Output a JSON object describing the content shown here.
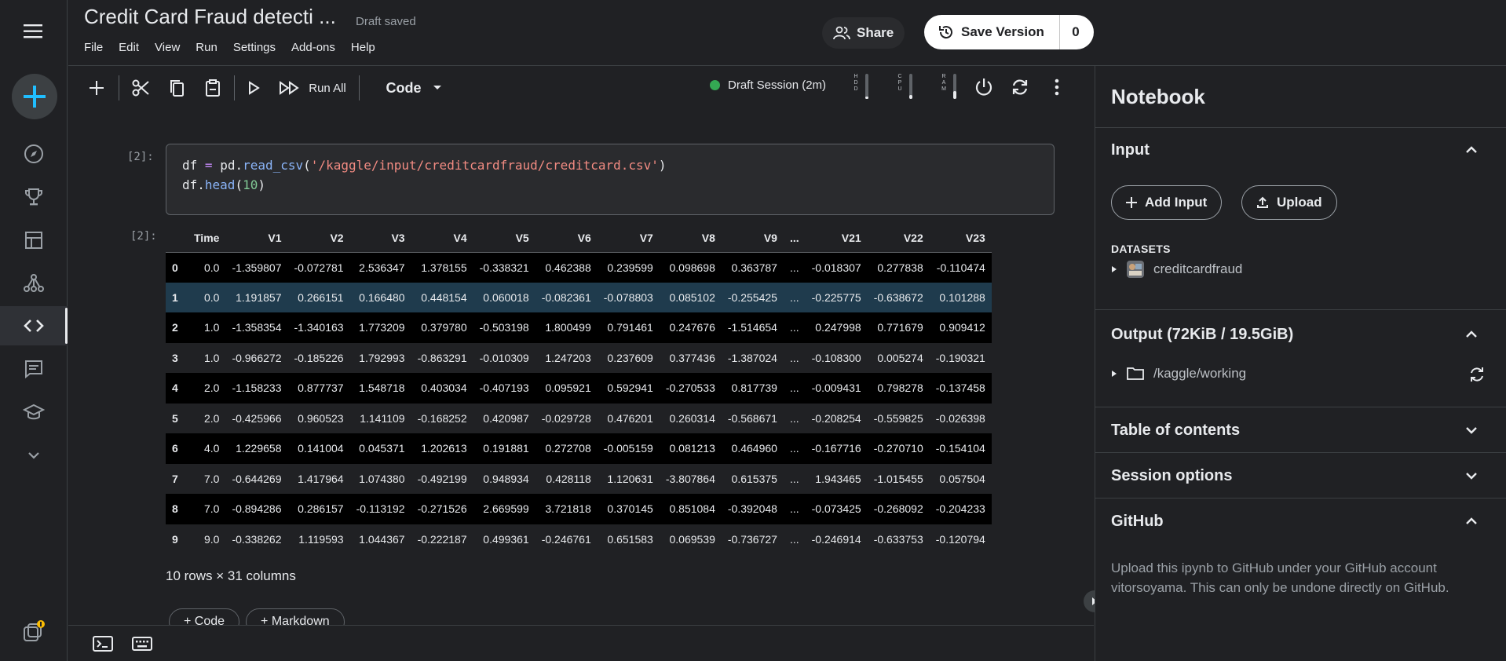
{
  "header": {
    "title": "Credit Card Fraud detecti ...",
    "saved_status": "Draft saved",
    "menu": [
      "File",
      "Edit",
      "View",
      "Run",
      "Settings",
      "Add-ons",
      "Help"
    ],
    "share_label": "Share",
    "save_version_label": "Save Version",
    "version_count": "0"
  },
  "toolbar": {
    "run_all_label": "Run All",
    "cell_type": "Code",
    "session_label": "Draft Session (2m)",
    "gauges": [
      {
        "label": [
          "H",
          "D",
          "D"
        ],
        "level": 0.1
      },
      {
        "label": [
          "C",
          "P",
          "U"
        ],
        "level": 0.15
      },
      {
        "label": [
          "R",
          "A",
          "M"
        ],
        "level": 0.3
      }
    ]
  },
  "cell": {
    "input_prompt": "[2]:",
    "output_prompt": "[2]:",
    "code_line1": {
      "a": "df",
      "op": "=",
      "b": "pd.",
      "fn": "read_csv",
      "c": "(",
      "str": "'/kaggle/input/creditcardfraud/creditcard.csv'",
      "d": ")"
    },
    "code_line2": {
      "a": "df.",
      "fn": "head",
      "c": "(",
      "num": "10",
      "d": ")"
    }
  },
  "table": {
    "columns": [
      "",
      "Time",
      "V1",
      "V2",
      "V3",
      "V4",
      "V5",
      "V6",
      "V7",
      "V8",
      "V9",
      "...",
      "V21",
      "V22",
      "V23"
    ],
    "rows": [
      [
        "0",
        "0.0",
        "-1.359807",
        "-0.072781",
        "2.536347",
        "1.378155",
        "-0.338321",
        "0.462388",
        "0.239599",
        "0.098698",
        "0.363787",
        "...",
        "-0.018307",
        "0.277838",
        "-0.110474"
      ],
      [
        "1",
        "0.0",
        "1.191857",
        "0.266151",
        "0.166480",
        "0.448154",
        "0.060018",
        "-0.082361",
        "-0.078803",
        "0.085102",
        "-0.255425",
        "...",
        "-0.225775",
        "-0.638672",
        "0.101288"
      ],
      [
        "2",
        "1.0",
        "-1.358354",
        "-1.340163",
        "1.773209",
        "0.379780",
        "-0.503198",
        "1.800499",
        "0.791461",
        "0.247676",
        "-1.514654",
        "...",
        "0.247998",
        "0.771679",
        "0.909412"
      ],
      [
        "3",
        "1.0",
        "-0.966272",
        "-0.185226",
        "1.792993",
        "-0.863291",
        "-0.010309",
        "1.247203",
        "0.237609",
        "0.377436",
        "-1.387024",
        "...",
        "-0.108300",
        "0.005274",
        "-0.190321"
      ],
      [
        "4",
        "2.0",
        "-1.158233",
        "0.877737",
        "1.548718",
        "0.403034",
        "-0.407193",
        "0.095921",
        "0.592941",
        "-0.270533",
        "0.817739",
        "...",
        "-0.009431",
        "0.798278",
        "-0.137458"
      ],
      [
        "5",
        "2.0",
        "-0.425966",
        "0.960523",
        "1.141109",
        "-0.168252",
        "0.420987",
        "-0.029728",
        "0.476201",
        "0.260314",
        "-0.568671",
        "...",
        "-0.208254",
        "-0.559825",
        "-0.026398"
      ],
      [
        "6",
        "4.0",
        "1.229658",
        "0.141004",
        "0.045371",
        "1.202613",
        "0.191881",
        "0.272708",
        "-0.005159",
        "0.081213",
        "0.464960",
        "...",
        "-0.167716",
        "-0.270710",
        "-0.154104"
      ],
      [
        "7",
        "7.0",
        "-0.644269",
        "1.417964",
        "1.074380",
        "-0.492199",
        "0.948934",
        "0.428118",
        "1.120631",
        "-3.807864",
        "0.615375",
        "...",
        "1.943465",
        "-1.015455",
        "0.057504"
      ],
      [
        "8",
        "7.0",
        "-0.894286",
        "0.286157",
        "-0.113192",
        "-0.271526",
        "2.669599",
        "3.721818",
        "0.370145",
        "0.851084",
        "-0.392048",
        "...",
        "-0.073425",
        "-0.268092",
        "-0.204233"
      ],
      [
        "9",
        "9.0",
        "-0.338262",
        "1.119593",
        "1.044367",
        "-0.222187",
        "0.499361",
        "-0.246761",
        "0.651583",
        "0.069539",
        "-0.736727",
        "...",
        "-0.246914",
        "-0.633753",
        "-0.120794"
      ]
    ],
    "shape_text": "10 rows × 31 columns"
  },
  "add_cell": {
    "code_label": "+ Code",
    "markdown_label": "+ Markdown"
  },
  "panel": {
    "title": "Notebook",
    "input": {
      "heading": "Input",
      "add_input_label": "Add Input",
      "upload_label": "Upload",
      "datasets_label": "DATASETS",
      "dataset_name": "creditcardfraud"
    },
    "output": {
      "heading": "Output (72KiB / 19.5GiB)",
      "folder": "/kaggle/working"
    },
    "toc_heading": "Table of contents",
    "session_heading": "Session options",
    "github": {
      "heading": "GitHub",
      "text": "Upload this ipynb to GitHub under your GitHub account vitorsoyama. This can only be undone directly on GitHub."
    }
  },
  "colors": {
    "accent": "#20beff",
    "session_dot": "#34a853",
    "badge": "#fbbc04",
    "highlight_row": "#1f3b4d"
  }
}
